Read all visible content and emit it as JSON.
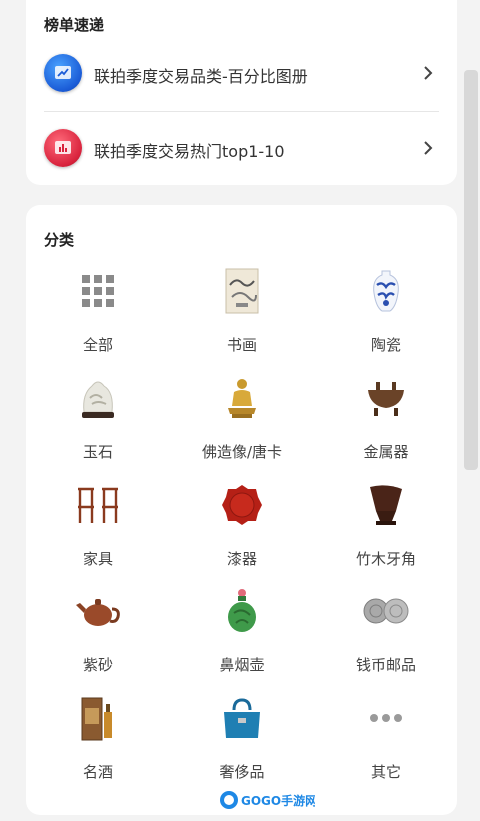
{
  "rankings": {
    "title": "榜单速递",
    "items": [
      {
        "label": "联拍季度交易品类-百分比图册",
        "icon": "pie-chart-icon",
        "color": "#1a5bd6"
      },
      {
        "label": "联拍季度交易热门top1-10",
        "icon": "bar-chart-icon",
        "color": "#d8223c"
      }
    ]
  },
  "categories": {
    "title": "分类",
    "items": [
      {
        "label": "全部",
        "icon": "grid-icon"
      },
      {
        "label": "书画",
        "icon": "painting-icon"
      },
      {
        "label": "陶瓷",
        "icon": "porcelain-vase-icon"
      },
      {
        "label": "玉石",
        "icon": "jade-carving-icon"
      },
      {
        "label": "佛造像/唐卡",
        "icon": "buddha-statue-icon"
      },
      {
        "label": "金属器",
        "icon": "bronze-censer-icon"
      },
      {
        "label": "家具",
        "icon": "chairs-icon"
      },
      {
        "label": "漆器",
        "icon": "lacquer-plate-icon"
      },
      {
        "label": "竹木牙角",
        "icon": "carved-cup-icon"
      },
      {
        "label": "紫砂",
        "icon": "teapot-icon"
      },
      {
        "label": "鼻烟壶",
        "icon": "snuff-bottle-icon"
      },
      {
        "label": "钱币邮品",
        "icon": "coins-icon"
      },
      {
        "label": "名酒",
        "icon": "liquor-bottle-icon"
      },
      {
        "label": "奢侈品",
        "icon": "handbag-icon"
      },
      {
        "label": "其它",
        "icon": "more-dots-icon"
      }
    ]
  },
  "watermark": {
    "text": "GOGO手游网"
  }
}
